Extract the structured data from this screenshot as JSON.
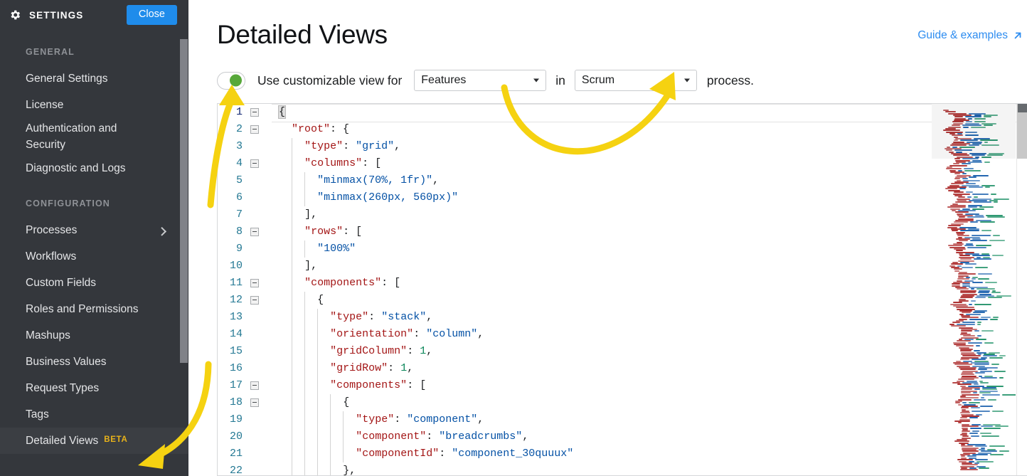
{
  "sidebar": {
    "title": "SETTINGS",
    "gear_icon": "gear-icon",
    "close_label": "Close",
    "close_color": "#1f8ceb",
    "sections": [
      {
        "label": "GENERAL",
        "items": [
          {
            "label": "General Settings",
            "active": false,
            "chevron": false,
            "badge": null
          },
          {
            "label": "License",
            "active": false,
            "chevron": false,
            "badge": null
          },
          {
            "label": "Authentication and\nSecurity",
            "active": false,
            "chevron": false,
            "badge": null
          },
          {
            "label": "Diagnostic and Logs",
            "active": false,
            "chevron": false,
            "badge": null
          }
        ]
      },
      {
        "label": "CONFIGURATION",
        "items": [
          {
            "label": "Processes",
            "active": false,
            "chevron": true,
            "badge": null
          },
          {
            "label": "Workflows",
            "active": false,
            "chevron": false,
            "badge": null
          },
          {
            "label": "Custom Fields",
            "active": false,
            "chevron": false,
            "badge": null
          },
          {
            "label": "Roles and Permissions",
            "active": false,
            "chevron": false,
            "badge": null
          },
          {
            "label": "Mashups",
            "active": false,
            "chevron": false,
            "badge": null
          },
          {
            "label": "Business Values",
            "active": false,
            "chevron": false,
            "badge": null
          },
          {
            "label": "Request Types",
            "active": false,
            "chevron": false,
            "badge": null
          },
          {
            "label": "Tags",
            "active": false,
            "chevron": false,
            "badge": null
          },
          {
            "label": "Detailed Views",
            "active": true,
            "chevron": false,
            "badge": "BETA"
          }
        ]
      }
    ],
    "badge_color": "#e8b21a"
  },
  "header": {
    "page_title": "Detailed Views",
    "guide_link": "Guide & examples",
    "guide_link_icon": "external-link-icon",
    "guide_link_color": "#2d8cf0"
  },
  "toggle_row": {
    "toggle_state": "on",
    "toggle_knob_color": "#57a83a",
    "text_before": "Use customizable view for",
    "entity_select": {
      "value": "Features",
      "caret": "chevron-down-icon"
    },
    "text_middle": "in",
    "process_select": {
      "value": "Scrum",
      "caret": "chevron-down-icon"
    },
    "text_after": "process."
  },
  "editor": {
    "active_line": 1,
    "lines": [
      {
        "n": 1,
        "fold": true,
        "indent": 0,
        "tokens": [
          {
            "t": "{",
            "c": "p bracket-hl"
          }
        ]
      },
      {
        "n": 2,
        "fold": true,
        "indent": 1,
        "tokens": [
          {
            "t": "\"root\"",
            "c": "k"
          },
          {
            "t": ": {",
            "c": "p"
          }
        ]
      },
      {
        "n": 3,
        "fold": false,
        "indent": 2,
        "tokens": [
          {
            "t": "\"type\"",
            "c": "k"
          },
          {
            "t": ": ",
            "c": "p"
          },
          {
            "t": "\"grid\"",
            "c": "s"
          },
          {
            "t": ",",
            "c": "p"
          }
        ]
      },
      {
        "n": 4,
        "fold": true,
        "indent": 2,
        "tokens": [
          {
            "t": "\"columns\"",
            "c": "k"
          },
          {
            "t": ": [",
            "c": "p"
          }
        ]
      },
      {
        "n": 5,
        "fold": false,
        "indent": 3,
        "tokens": [
          {
            "t": "\"minmax(70%, 1fr)\"",
            "c": "s"
          },
          {
            "t": ",",
            "c": "p"
          }
        ]
      },
      {
        "n": 6,
        "fold": false,
        "indent": 3,
        "tokens": [
          {
            "t": "\"minmax(260px, 560px)\"",
            "c": "s"
          }
        ]
      },
      {
        "n": 7,
        "fold": false,
        "indent": 2,
        "tokens": [
          {
            "t": "],",
            "c": "p"
          }
        ]
      },
      {
        "n": 8,
        "fold": true,
        "indent": 2,
        "tokens": [
          {
            "t": "\"rows\"",
            "c": "k"
          },
          {
            "t": ": [",
            "c": "p"
          }
        ]
      },
      {
        "n": 9,
        "fold": false,
        "indent": 3,
        "tokens": [
          {
            "t": "\"100%\"",
            "c": "s"
          }
        ]
      },
      {
        "n": 10,
        "fold": false,
        "indent": 2,
        "tokens": [
          {
            "t": "],",
            "c": "p"
          }
        ]
      },
      {
        "n": 11,
        "fold": true,
        "indent": 2,
        "tokens": [
          {
            "t": "\"components\"",
            "c": "k"
          },
          {
            "t": ": [",
            "c": "p"
          }
        ]
      },
      {
        "n": 12,
        "fold": true,
        "indent": 3,
        "tokens": [
          {
            "t": "{",
            "c": "p"
          }
        ]
      },
      {
        "n": 13,
        "fold": false,
        "indent": 4,
        "tokens": [
          {
            "t": "\"type\"",
            "c": "k"
          },
          {
            "t": ": ",
            "c": "p"
          },
          {
            "t": "\"stack\"",
            "c": "s"
          },
          {
            "t": ",",
            "c": "p"
          }
        ]
      },
      {
        "n": 14,
        "fold": false,
        "indent": 4,
        "tokens": [
          {
            "t": "\"orientation\"",
            "c": "k"
          },
          {
            "t": ": ",
            "c": "p"
          },
          {
            "t": "\"column\"",
            "c": "s"
          },
          {
            "t": ",",
            "c": "p"
          }
        ]
      },
      {
        "n": 15,
        "fold": false,
        "indent": 4,
        "tokens": [
          {
            "t": "\"gridColumn\"",
            "c": "k"
          },
          {
            "t": ": ",
            "c": "p"
          },
          {
            "t": "1",
            "c": "n"
          },
          {
            "t": ",",
            "c": "p"
          }
        ]
      },
      {
        "n": 16,
        "fold": false,
        "indent": 4,
        "tokens": [
          {
            "t": "\"gridRow\"",
            "c": "k"
          },
          {
            "t": ": ",
            "c": "p"
          },
          {
            "t": "1",
            "c": "n"
          },
          {
            "t": ",",
            "c": "p"
          }
        ]
      },
      {
        "n": 17,
        "fold": true,
        "indent": 4,
        "tokens": [
          {
            "t": "\"components\"",
            "c": "k"
          },
          {
            "t": ": [",
            "c": "p"
          }
        ]
      },
      {
        "n": 18,
        "fold": true,
        "indent": 5,
        "tokens": [
          {
            "t": "{",
            "c": "p"
          }
        ]
      },
      {
        "n": 19,
        "fold": false,
        "indent": 6,
        "tokens": [
          {
            "t": "\"type\"",
            "c": "k"
          },
          {
            "t": ": ",
            "c": "p"
          },
          {
            "t": "\"component\"",
            "c": "s"
          },
          {
            "t": ",",
            "c": "p"
          }
        ]
      },
      {
        "n": 20,
        "fold": false,
        "indent": 6,
        "tokens": [
          {
            "t": "\"component\"",
            "c": "k"
          },
          {
            "t": ": ",
            "c": "p"
          },
          {
            "t": "\"breadcrumbs\"",
            "c": "s"
          },
          {
            "t": ",",
            "c": "p"
          }
        ]
      },
      {
        "n": 21,
        "fold": false,
        "indent": 6,
        "tokens": [
          {
            "t": "\"componentId\"",
            "c": "k"
          },
          {
            "t": ": ",
            "c": "p"
          },
          {
            "t": "\"component_30quuux\"",
            "c": "s"
          }
        ]
      },
      {
        "n": 22,
        "fold": false,
        "indent": 5,
        "tokens": [
          {
            "t": "},",
            "c": "p"
          }
        ]
      }
    ],
    "minimap": "code-minimap",
    "scrollbar": "vertical-scrollbar"
  },
  "annotations": {
    "arrow_color": "#f5d211",
    "arrows": [
      {
        "name": "arrow-to-toggle",
        "target": "view-toggle"
      },
      {
        "name": "arrow-to-process-select",
        "target": "process-select"
      },
      {
        "name": "arrow-to-detailed-views",
        "target": "sidebar-item-detailed-views"
      }
    ]
  }
}
